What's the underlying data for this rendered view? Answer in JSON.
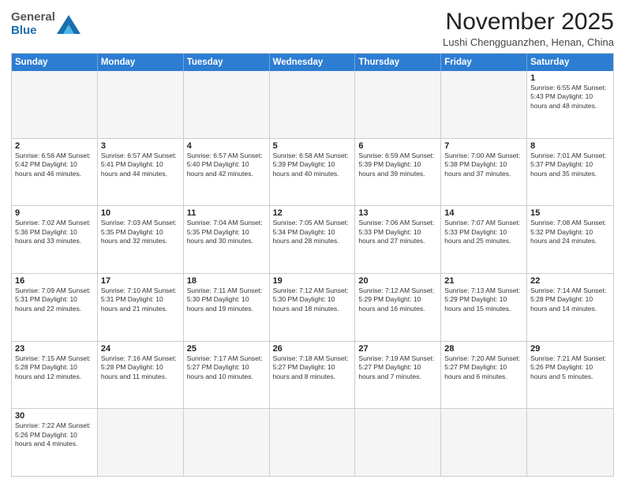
{
  "logo": {
    "line1": "General",
    "line2": "Blue"
  },
  "title": "November 2025",
  "location": "Lushi Chengguanzhen, Henan, China",
  "header_days": [
    "Sunday",
    "Monday",
    "Tuesday",
    "Wednesday",
    "Thursday",
    "Friday",
    "Saturday"
  ],
  "weeks": [
    [
      {
        "day": "",
        "info": ""
      },
      {
        "day": "",
        "info": ""
      },
      {
        "day": "",
        "info": ""
      },
      {
        "day": "",
        "info": ""
      },
      {
        "day": "",
        "info": ""
      },
      {
        "day": "",
        "info": ""
      },
      {
        "day": "1",
        "info": "Sunrise: 6:55 AM\nSunset: 5:43 PM\nDaylight: 10 hours and 48 minutes."
      }
    ],
    [
      {
        "day": "2",
        "info": "Sunrise: 6:56 AM\nSunset: 5:42 PM\nDaylight: 10 hours and 46 minutes."
      },
      {
        "day": "3",
        "info": "Sunrise: 6:57 AM\nSunset: 5:41 PM\nDaylight: 10 hours and 44 minutes."
      },
      {
        "day": "4",
        "info": "Sunrise: 6:57 AM\nSunset: 5:40 PM\nDaylight: 10 hours and 42 minutes."
      },
      {
        "day": "5",
        "info": "Sunrise: 6:58 AM\nSunset: 5:39 PM\nDaylight: 10 hours and 40 minutes."
      },
      {
        "day": "6",
        "info": "Sunrise: 6:59 AM\nSunset: 5:39 PM\nDaylight: 10 hours and 39 minutes."
      },
      {
        "day": "7",
        "info": "Sunrise: 7:00 AM\nSunset: 5:38 PM\nDaylight: 10 hours and 37 minutes."
      },
      {
        "day": "8",
        "info": "Sunrise: 7:01 AM\nSunset: 5:37 PM\nDaylight: 10 hours and 35 minutes."
      }
    ],
    [
      {
        "day": "9",
        "info": "Sunrise: 7:02 AM\nSunset: 5:36 PM\nDaylight: 10 hours and 33 minutes."
      },
      {
        "day": "10",
        "info": "Sunrise: 7:03 AM\nSunset: 5:35 PM\nDaylight: 10 hours and 32 minutes."
      },
      {
        "day": "11",
        "info": "Sunrise: 7:04 AM\nSunset: 5:35 PM\nDaylight: 10 hours and 30 minutes."
      },
      {
        "day": "12",
        "info": "Sunrise: 7:05 AM\nSunset: 5:34 PM\nDaylight: 10 hours and 28 minutes."
      },
      {
        "day": "13",
        "info": "Sunrise: 7:06 AM\nSunset: 5:33 PM\nDaylight: 10 hours and 27 minutes."
      },
      {
        "day": "14",
        "info": "Sunrise: 7:07 AM\nSunset: 5:33 PM\nDaylight: 10 hours and 25 minutes."
      },
      {
        "day": "15",
        "info": "Sunrise: 7:08 AM\nSunset: 5:32 PM\nDaylight: 10 hours and 24 minutes."
      }
    ],
    [
      {
        "day": "16",
        "info": "Sunrise: 7:09 AM\nSunset: 5:31 PM\nDaylight: 10 hours and 22 minutes."
      },
      {
        "day": "17",
        "info": "Sunrise: 7:10 AM\nSunset: 5:31 PM\nDaylight: 10 hours and 21 minutes."
      },
      {
        "day": "18",
        "info": "Sunrise: 7:11 AM\nSunset: 5:30 PM\nDaylight: 10 hours and 19 minutes."
      },
      {
        "day": "19",
        "info": "Sunrise: 7:12 AM\nSunset: 5:30 PM\nDaylight: 10 hours and 18 minutes."
      },
      {
        "day": "20",
        "info": "Sunrise: 7:12 AM\nSunset: 5:29 PM\nDaylight: 10 hours and 16 minutes."
      },
      {
        "day": "21",
        "info": "Sunrise: 7:13 AM\nSunset: 5:29 PM\nDaylight: 10 hours and 15 minutes."
      },
      {
        "day": "22",
        "info": "Sunrise: 7:14 AM\nSunset: 5:28 PM\nDaylight: 10 hours and 14 minutes."
      }
    ],
    [
      {
        "day": "23",
        "info": "Sunrise: 7:15 AM\nSunset: 5:28 PM\nDaylight: 10 hours and 12 minutes."
      },
      {
        "day": "24",
        "info": "Sunrise: 7:16 AM\nSunset: 5:28 PM\nDaylight: 10 hours and 11 minutes."
      },
      {
        "day": "25",
        "info": "Sunrise: 7:17 AM\nSunset: 5:27 PM\nDaylight: 10 hours and 10 minutes."
      },
      {
        "day": "26",
        "info": "Sunrise: 7:18 AM\nSunset: 5:27 PM\nDaylight: 10 hours and 8 minutes."
      },
      {
        "day": "27",
        "info": "Sunrise: 7:19 AM\nSunset: 5:27 PM\nDaylight: 10 hours and 7 minutes."
      },
      {
        "day": "28",
        "info": "Sunrise: 7:20 AM\nSunset: 5:27 PM\nDaylight: 10 hours and 6 minutes."
      },
      {
        "day": "29",
        "info": "Sunrise: 7:21 AM\nSunset: 5:26 PM\nDaylight: 10 hours and 5 minutes."
      }
    ],
    [
      {
        "day": "30",
        "info": "Sunrise: 7:22 AM\nSunset: 5:26 PM\nDaylight: 10 hours and 4 minutes."
      },
      {
        "day": "",
        "info": ""
      },
      {
        "day": "",
        "info": ""
      },
      {
        "day": "",
        "info": ""
      },
      {
        "day": "",
        "info": ""
      },
      {
        "day": "",
        "info": ""
      },
      {
        "day": "",
        "info": ""
      }
    ]
  ]
}
